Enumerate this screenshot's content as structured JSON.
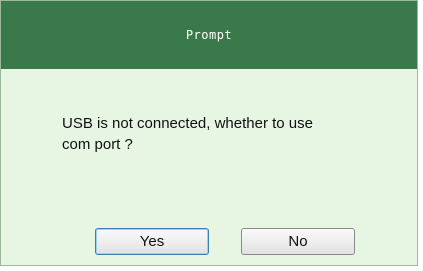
{
  "dialog": {
    "title": "Prompt",
    "message_line1": "USB is not connected, whether to use",
    "message_line2": "com port ?",
    "buttons": {
      "yes_label": "Yes",
      "no_label": "No"
    }
  },
  "colors": {
    "titlebar": "#3a7a4a",
    "dialog_background": "#e6f6e3",
    "default_button_border": "#3c7fb1"
  }
}
